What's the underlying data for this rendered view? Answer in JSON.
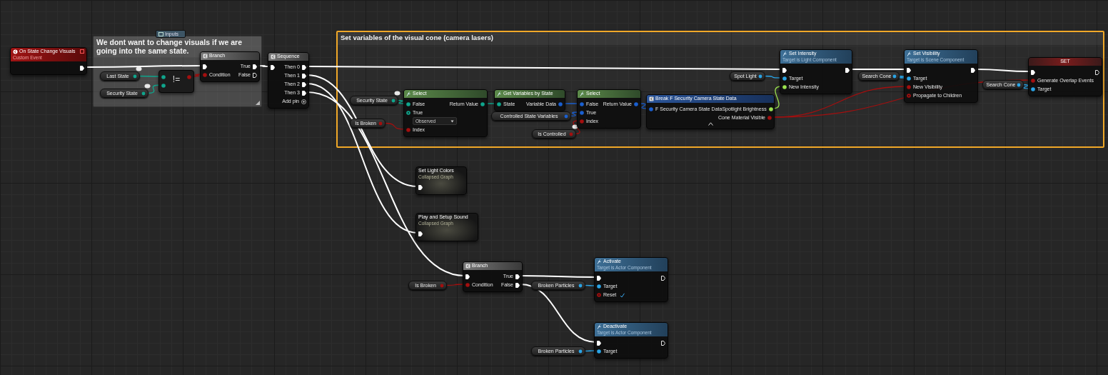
{
  "comments": [
    {
      "title": "We dont want to change visuals if we are going into the same state.",
      "selected": false
    },
    {
      "title": "Set variables of the visual cone (camera lasers)",
      "selected": true
    }
  ],
  "tag": {
    "label": "Inputs"
  },
  "nodes": [
    {
      "kind": "event",
      "title": "On State Change Visuals",
      "subtitle": "Custom Event",
      "rows": [
        {
          "out": {
            "kind": "exec",
            "connected": true
          }
        }
      ]
    },
    {
      "kind": "variable",
      "label": "Last State",
      "color": "#0fa58c",
      "badge": true
    },
    {
      "kind": "variable",
      "label": "Security State",
      "color": "#0fa58c",
      "badge": true
    },
    {
      "kind": "compare",
      "symbol": "!=",
      "rows": [
        {
          "in": {
            "kind": "data",
            "color": "#0fa58c",
            "connected": true
          },
          "out": {
            "kind": "data",
            "color": "#a30f0f",
            "connected": true
          }
        },
        {
          "in": {
            "kind": "data",
            "color": "#0fa58c",
            "connected": true
          }
        }
      ]
    },
    {
      "kind": "flow",
      "title": "Branch",
      "rows": [
        {
          "in": {
            "kind": "exec",
            "connected": true
          },
          "out": {
            "kind": "exec",
            "label": "True",
            "connected": true
          }
        },
        {
          "in": {
            "kind": "data",
            "color": "#a30f0f",
            "label": "Condition",
            "connected": true
          },
          "out": {
            "kind": "exec",
            "label": "False",
            "connected": false
          }
        }
      ]
    },
    {
      "kind": "flow",
      "title": "Sequence",
      "rows": [
        {
          "in": {
            "kind": "exec",
            "connected": true
          },
          "out": {
            "kind": "exec",
            "label": "Then 0",
            "connected": true
          }
        },
        {
          "out": {
            "kind": "exec",
            "label": "Then 1",
            "connected": true
          }
        },
        {
          "out": {
            "kind": "exec",
            "label": "Then 2",
            "connected": true
          }
        },
        {
          "out": {
            "kind": "exec",
            "label": "Then 3",
            "connected": true
          }
        },
        {
          "out": {
            "kind": "add",
            "label": "Add pin",
            "connected": false
          }
        }
      ]
    },
    {
      "kind": "variable",
      "label": "Security State",
      "color": "#0fa58c",
      "badge": true
    },
    {
      "kind": "variable",
      "label": "Is Broken",
      "color": "#a30f0f",
      "badge": false
    },
    {
      "kind": "pure",
      "title": "Select",
      "rows": [
        {
          "in": {
            "kind": "data",
            "color": "#0fa58c",
            "label": "False",
            "connected": true
          },
          "out": {
            "kind": "data",
            "color": "#0fa58c",
            "label": "Return Value",
            "connected": true
          }
        },
        {
          "in": {
            "kind": "data",
            "color": "#0fa58c",
            "label": "True",
            "connected": false,
            "value": "Observed"
          }
        },
        {
          "in": {
            "kind": "data",
            "color": "#a30f0f",
            "label": "Index",
            "connected": true
          }
        }
      ]
    },
    {
      "kind": "pure",
      "title": "Get Variables by State",
      "rows": [
        {
          "in": {
            "kind": "data",
            "color": "#0fa58c",
            "label": "State",
            "connected": true
          },
          "out": {
            "kind": "data",
            "color": "#1a5fd0",
            "label": "Variable Data",
            "connected": true
          }
        }
      ]
    },
    {
      "kind": "variable",
      "label": "Controlled State Variables",
      "color": "#1a5fd0",
      "badge": false
    },
    {
      "kind": "variable",
      "label": "Is Controlled",
      "color": "#a30f0f",
      "badge": true
    },
    {
      "kind": "pure",
      "title": "Select",
      "rows": [
        {
          "in": {
            "kind": "data",
            "color": "#1a5fd0",
            "label": "False",
            "connected": true
          },
          "out": {
            "kind": "data",
            "color": "#1a5fd0",
            "label": "Return Value",
            "connected": true
          }
        },
        {
          "in": {
            "kind": "data",
            "color": "#1a5fd0",
            "label": "True",
            "connected": true
          }
        },
        {
          "in": {
            "kind": "data",
            "color": "#a30f0f",
            "label": "Index",
            "connected": true
          }
        }
      ]
    },
    {
      "kind": "variable",
      "label": "Spot Light",
      "color": "#2aa4e6",
      "badge": false
    },
    {
      "kind": "break",
      "title": "Break F Security Camera State Data",
      "rows": [
        {
          "in": {
            "kind": "data",
            "color": "#1a5fd0",
            "label": "F Security Camera State Data",
            "connected": true
          },
          "out": {
            "kind": "data",
            "color": "#9be24f",
            "label": "Spotlight Brightness",
            "connected": true
          }
        },
        {
          "out": {
            "kind": "data",
            "color": "#a30f0f",
            "label": "Cone Material Visible",
            "connected": true
          }
        }
      ]
    },
    {
      "kind": "function",
      "title": "Set Intensity",
      "subtitle": "Target is Light Component",
      "rows": [
        {
          "in": {
            "kind": "exec",
            "connected": true
          },
          "out": {
            "kind": "exec",
            "connected": true
          }
        },
        {
          "in": {
            "kind": "data",
            "color": "#2aa4e6",
            "label": "Target",
            "connected": true
          }
        },
        {
          "in": {
            "kind": "data",
            "color": "#9be24f",
            "label": "New Intensity",
            "connected": true
          }
        }
      ]
    },
    {
      "kind": "variable",
      "label": "Search Cone",
      "color": "#2aa4e6",
      "badge": false
    },
    {
      "kind": "function",
      "title": "Set Visibility",
      "subtitle": "Target is Scene Component",
      "rows": [
        {
          "in": {
            "kind": "exec",
            "connected": true
          },
          "out": {
            "kind": "exec",
            "connected": true
          }
        },
        {
          "in": {
            "kind": "data",
            "color": "#2aa4e6",
            "label": "Target",
            "connected": true
          }
        },
        {
          "in": {
            "kind": "data",
            "color": "#a30f0f",
            "label": "New Visibility",
            "connected": true
          }
        },
        {
          "in": {
            "kind": "data",
            "color": "#a30f0f",
            "label": "Propagate to Children",
            "connected": false
          }
        }
      ]
    },
    {
      "kind": "variable",
      "label": "Search Cone",
      "color": "#2aa4e6",
      "badge": false
    },
    {
      "kind": "set",
      "title": "SET",
      "rows": [
        {
          "in": {
            "kind": "exec",
            "connected": true
          },
          "out": {
            "kind": "exec",
            "connected": false
          }
        },
        {
          "in": {
            "kind": "data",
            "color": "#a30f0f",
            "label": "Generate Overlap Events",
            "connected": true
          }
        },
        {
          "in": {
            "kind": "data",
            "color": "#2aa4e6",
            "label": "Target",
            "connected": true
          }
        }
      ]
    },
    {
      "kind": "collapsed",
      "title": "Set Light Colors",
      "subtitle": "Collapsed Graph",
      "rows": [
        {
          "in": {
            "kind": "exec",
            "connected": true
          }
        }
      ]
    },
    {
      "kind": "collapsed",
      "title": "Play and Setup Sound",
      "subtitle": "Collapsed Graph",
      "rows": [
        {
          "in": {
            "kind": "exec",
            "connected": true
          }
        }
      ]
    },
    {
      "kind": "variable",
      "label": "Is Broken",
      "color": "#a30f0f",
      "badge": false
    },
    {
      "kind": "flow",
      "title": "Branch",
      "rows": [
        {
          "in": {
            "kind": "exec",
            "connected": true
          },
          "out": {
            "kind": "exec",
            "label": "True",
            "connected": true
          }
        },
        {
          "in": {
            "kind": "data",
            "color": "#a30f0f",
            "label": "Condition",
            "connected": true
          },
          "out": {
            "kind": "exec",
            "label": "False",
            "connected": true
          }
        }
      ]
    },
    {
      "kind": "variable",
      "label": "Broken Particles",
      "color": "#2aa4e6",
      "badge": false
    },
    {
      "kind": "function",
      "title": "Activate",
      "subtitle": "Target is Actor Component",
      "rows": [
        {
          "in": {
            "kind": "exec",
            "connected": true
          },
          "out": {
            "kind": "exec",
            "connected": false
          }
        },
        {
          "in": {
            "kind": "data",
            "color": "#2aa4e6",
            "label": "Target",
            "connected": true
          }
        },
        {
          "in": {
            "kind": "data",
            "color": "#a30f0f",
            "label": "Reset",
            "connected": false,
            "checked": true
          }
        }
      ]
    },
    {
      "kind": "variable",
      "label": "Broken Particles",
      "color": "#2aa4e6",
      "badge": false
    },
    {
      "kind": "function",
      "title": "Deactivate",
      "subtitle": "Target is Actor Component",
      "rows": [
        {
          "in": {
            "kind": "exec",
            "connected": true
          },
          "out": {
            "kind": "exec",
            "connected": false
          }
        },
        {
          "in": {
            "kind": "data",
            "color": "#2aa4e6",
            "label": "Target",
            "connected": true
          }
        }
      ]
    }
  ]
}
